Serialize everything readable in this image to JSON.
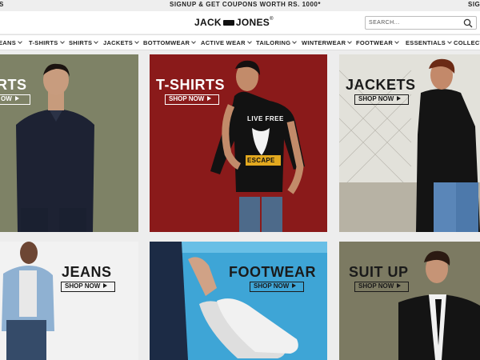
{
  "promo": {
    "text": "SIGNUP & GET COUPONS WORTH RS. 1000*",
    "left_fragment": "S",
    "right_fragment": "SIGI"
  },
  "brand": {
    "part1": "JACK",
    "part2": "JONES",
    "trademark": "®"
  },
  "search": {
    "placeholder": "SEARCH...",
    "icon": "search-icon"
  },
  "nav": [
    {
      "label": "EANS"
    },
    {
      "label": "T-SHIRTS"
    },
    {
      "label": "SHIRTS"
    },
    {
      "label": "JACKETS"
    },
    {
      "label": "BOTTOMWEAR"
    },
    {
      "label": "ACTIVE WEAR"
    },
    {
      "label": "TAILORING"
    },
    {
      "label": "WINTERWEAR"
    },
    {
      "label": "FOOTWEAR"
    },
    {
      "label": "ESSENTIALS"
    },
    {
      "label": "COLLECT"
    }
  ],
  "tiles": [
    {
      "title": "RTS",
      "cta": "OW"
    },
    {
      "title": "T-SHIRTS",
      "cta": "SHOP NOW",
      "shirt_text_1": "LIVE FREE",
      "shirt_text_2": "ESCAPE"
    },
    {
      "title": "JACKETS",
      "cta": "SHOP NOW"
    },
    {
      "title": "JEANS",
      "cta": "SHOP NOW"
    },
    {
      "title": "FOOTWEAR",
      "cta": "SHOP NOW"
    },
    {
      "title": "SUIT UP",
      "cta": "SHOP NOW"
    }
  ],
  "colors": {
    "tile_olive": "#7e8266",
    "tile_red": "#8a1a1a",
    "tile_jackets": "#e7e6e0",
    "tile_jeans": "#f2f2f2",
    "tile_footwear": "#3ea5d6",
    "tile_suit": "#7c7a62"
  }
}
